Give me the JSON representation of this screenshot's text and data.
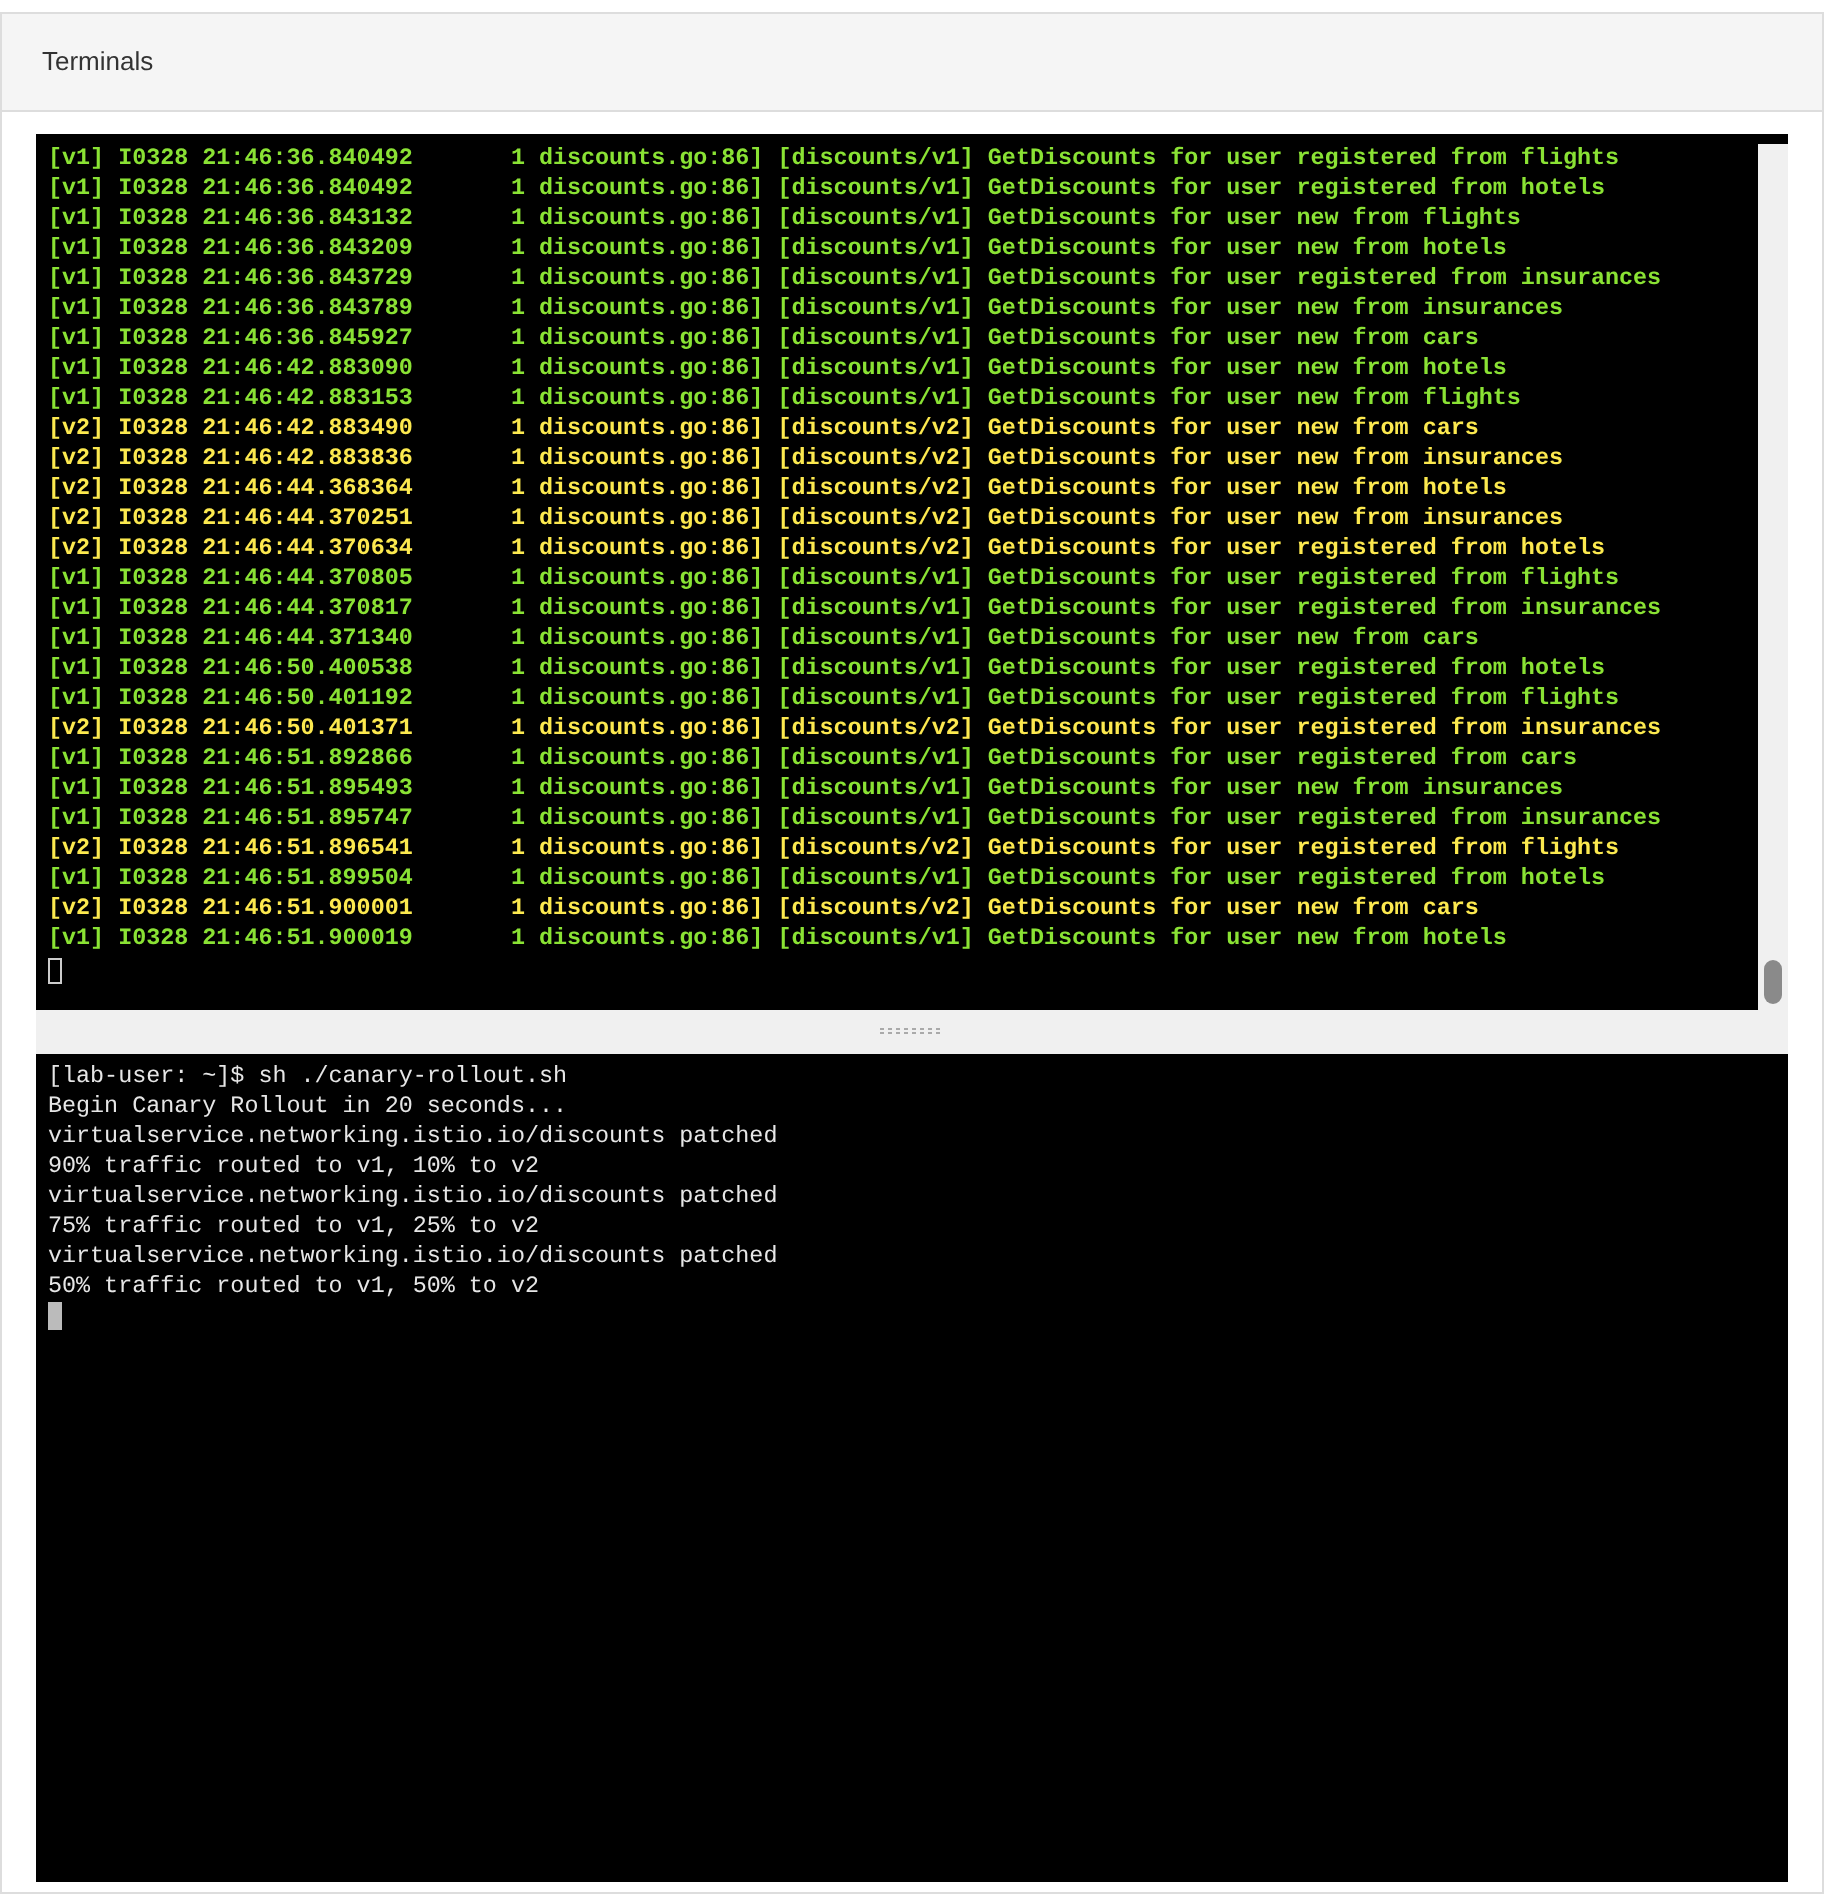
{
  "panel": {
    "title": "Terminals"
  },
  "log_terminal": {
    "lines": [
      {
        "kind": "v1",
        "text": "[v1] I0328 21:46:36.840492       1 discounts.go:86] [discounts/v1] GetDiscounts for user registered from flights"
      },
      {
        "kind": "v1",
        "text": "[v1] I0328 21:46:36.840492       1 discounts.go:86] [discounts/v1] GetDiscounts for user registered from hotels"
      },
      {
        "kind": "v1",
        "text": "[v1] I0328 21:46:36.843132       1 discounts.go:86] [discounts/v1] GetDiscounts for user new from flights"
      },
      {
        "kind": "v1",
        "text": "[v1] I0328 21:46:36.843209       1 discounts.go:86] [discounts/v1] GetDiscounts for user new from hotels"
      },
      {
        "kind": "v1",
        "text": "[v1] I0328 21:46:36.843729       1 discounts.go:86] [discounts/v1] GetDiscounts for user registered from insurances"
      },
      {
        "kind": "v1",
        "text": "[v1] I0328 21:46:36.843789       1 discounts.go:86] [discounts/v1] GetDiscounts for user new from insurances"
      },
      {
        "kind": "v1",
        "text": "[v1] I0328 21:46:36.845927       1 discounts.go:86] [discounts/v1] GetDiscounts for user new from cars"
      },
      {
        "kind": "v1",
        "text": "[v1] I0328 21:46:42.883090       1 discounts.go:86] [discounts/v1] GetDiscounts for user new from hotels"
      },
      {
        "kind": "v1",
        "text": "[v1] I0328 21:46:42.883153       1 discounts.go:86] [discounts/v1] GetDiscounts for user new from flights"
      },
      {
        "kind": "v2",
        "text": "[v2] I0328 21:46:42.883490       1 discounts.go:86] [discounts/v2] GetDiscounts for user new from cars"
      },
      {
        "kind": "v2",
        "text": "[v2] I0328 21:46:42.883836       1 discounts.go:86] [discounts/v2] GetDiscounts for user new from insurances"
      },
      {
        "kind": "v2",
        "text": "[v2] I0328 21:46:44.368364       1 discounts.go:86] [discounts/v2] GetDiscounts for user new from hotels"
      },
      {
        "kind": "v2",
        "text": "[v2] I0328 21:46:44.370251       1 discounts.go:86] [discounts/v2] GetDiscounts for user new from insurances"
      },
      {
        "kind": "v2",
        "text": "[v2] I0328 21:46:44.370634       1 discounts.go:86] [discounts/v2] GetDiscounts for user registered from hotels"
      },
      {
        "kind": "v1",
        "text": "[v1] I0328 21:46:44.370805       1 discounts.go:86] [discounts/v1] GetDiscounts for user registered from flights"
      },
      {
        "kind": "v1",
        "text": "[v1] I0328 21:46:44.370817       1 discounts.go:86] [discounts/v1] GetDiscounts for user registered from insurances"
      },
      {
        "kind": "v1",
        "text": "[v1] I0328 21:46:44.371340       1 discounts.go:86] [discounts/v1] GetDiscounts for user new from cars"
      },
      {
        "kind": "v1",
        "text": "[v1] I0328 21:46:50.400538       1 discounts.go:86] [discounts/v1] GetDiscounts for user registered from hotels"
      },
      {
        "kind": "v1",
        "text": "[v1] I0328 21:46:50.401192       1 discounts.go:86] [discounts/v1] GetDiscounts for user registered from flights"
      },
      {
        "kind": "v2",
        "text": "[v2] I0328 21:46:50.401371       1 discounts.go:86] [discounts/v2] GetDiscounts for user registered from insurances"
      },
      {
        "kind": "v1",
        "text": "[v1] I0328 21:46:51.892866       1 discounts.go:86] [discounts/v1] GetDiscounts for user registered from cars"
      },
      {
        "kind": "v1",
        "text": "[v1] I0328 21:46:51.895493       1 discounts.go:86] [discounts/v1] GetDiscounts for user new from insurances"
      },
      {
        "kind": "v1",
        "text": "[v1] I0328 21:46:51.895747       1 discounts.go:86] [discounts/v1] GetDiscounts for user registered from insurances"
      },
      {
        "kind": "v2",
        "text": "[v2] I0328 21:46:51.896541       1 discounts.go:86] [discounts/v2] GetDiscounts for user registered from flights"
      },
      {
        "kind": "v1",
        "text": "[v1] I0328 21:46:51.899504       1 discounts.go:86] [discounts/v1] GetDiscounts for user registered from hotels"
      },
      {
        "kind": "v2",
        "text": "[v2] I0328 21:46:51.900001       1 discounts.go:86] [discounts/v2] GetDiscounts for user new from cars"
      },
      {
        "kind": "v1",
        "text": "[v1] I0328 21:46:51.900019       1 discounts.go:86] [discounts/v1] GetDiscounts for user new from hotels"
      }
    ]
  },
  "shell_terminal": {
    "lines": [
      "[lab-user: ~]$ sh ./canary-rollout.sh",
      "Begin Canary Rollout in 20 seconds...",
      "virtualservice.networking.istio.io/discounts patched",
      "90% traffic routed to v1, 10% to v2",
      "virtualservice.networking.istio.io/discounts patched",
      "75% traffic routed to v1, 25% to v2",
      "virtualservice.networking.istio.io/discounts patched",
      "50% traffic routed to v1, 50% to v2"
    ]
  }
}
